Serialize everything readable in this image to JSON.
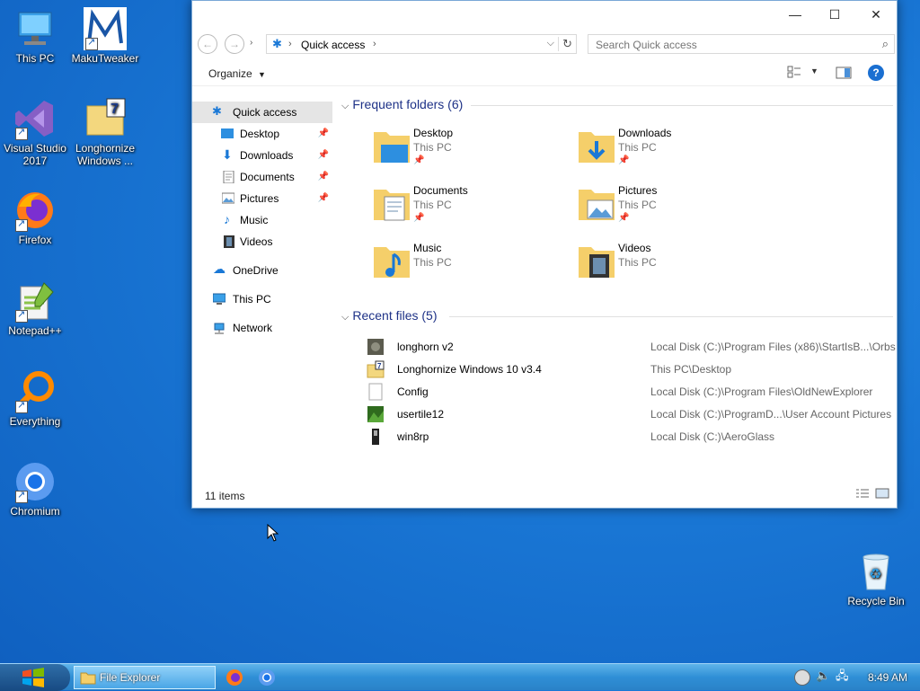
{
  "desktop": {
    "icons": [
      {
        "label": "This PC"
      },
      {
        "label": "MakuTweaker"
      },
      {
        "label": "Visual Studio 2017"
      },
      {
        "label": "Longhornize Windows ..."
      },
      {
        "label": "Firefox"
      },
      {
        "label": "Notepad++"
      },
      {
        "label": "Everything"
      },
      {
        "label": "Chromium"
      },
      {
        "label": "Recycle Bin"
      }
    ]
  },
  "window": {
    "caption_buttons": {
      "minimize": "—",
      "maximize": "☐",
      "close": "✕"
    },
    "address": {
      "path": "Quick access"
    },
    "search": {
      "placeholder": "Search Quick access"
    },
    "toolbar": {
      "organize": "Organize"
    },
    "nav": [
      {
        "label": "Quick access",
        "pinned": false
      },
      {
        "label": "Desktop",
        "pinned": true
      },
      {
        "label": "Downloads",
        "pinned": true
      },
      {
        "label": "Documents",
        "pinned": true
      },
      {
        "label": "Pictures",
        "pinned": true
      },
      {
        "label": "Music",
        "pinned": false
      },
      {
        "label": "Videos",
        "pinned": false
      },
      {
        "label": "OneDrive",
        "pinned": false
      },
      {
        "label": "This PC",
        "pinned": false
      },
      {
        "label": "Network",
        "pinned": false
      }
    ],
    "frequent_header": "Frequent folders (6)",
    "frequent": [
      {
        "name": "Desktop",
        "location": "This PC",
        "pinned": true
      },
      {
        "name": "Downloads",
        "location": "This PC",
        "pinned": true
      },
      {
        "name": "Documents",
        "location": "This PC",
        "pinned": true
      },
      {
        "name": "Pictures",
        "location": "This PC",
        "pinned": true
      },
      {
        "name": "Music",
        "location": "This PC",
        "pinned": false
      },
      {
        "name": "Videos",
        "location": "This PC",
        "pinned": false
      }
    ],
    "recent_header": "Recent files (5)",
    "recent": [
      {
        "name": "longhorn v2",
        "path": "Local Disk (C:)\\Program Files (x86)\\StartIsB...\\Orbs"
      },
      {
        "name": "Longhornize Windows 10 v3.4",
        "path": "This PC\\Desktop"
      },
      {
        "name": "Config",
        "path": "Local Disk (C:)\\Program Files\\OldNewExplorer"
      },
      {
        "name": "usertile12",
        "path": "Local Disk (C:)\\ProgramD...\\User Account Pictures"
      },
      {
        "name": "win8rp",
        "path": "Local Disk (C:)\\AeroGlass"
      }
    ],
    "status": "11 items"
  },
  "taskbar": {
    "active_item": "File Explorer",
    "clock": "8:49 AM"
  },
  "colors": {
    "accent": "#1e3287",
    "selection": "#e5e5e5",
    "taskbar": "#2f8fd6"
  }
}
